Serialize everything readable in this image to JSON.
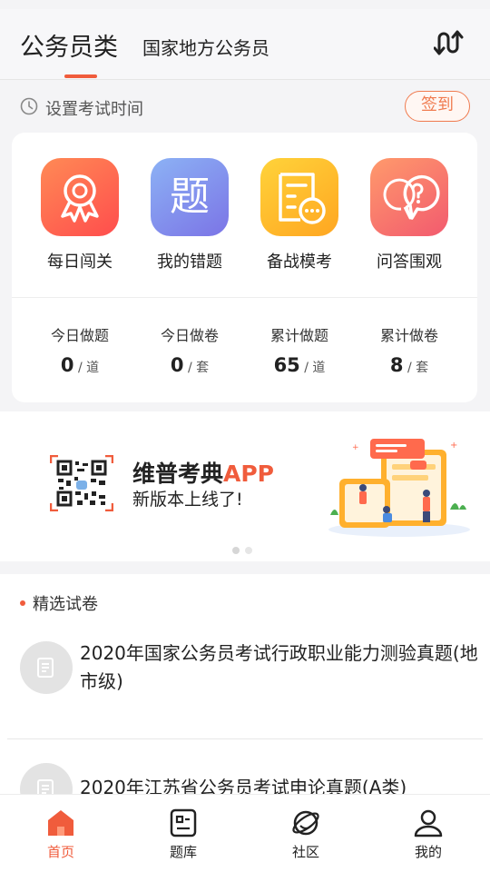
{
  "header": {
    "title": "公务员类",
    "subtitle": "国家地方公务员"
  },
  "exam_time": {
    "label": "设置考试时间",
    "signin_button": "签到"
  },
  "features": [
    {
      "label": "每日闯关",
      "icon": "award-badge-icon"
    },
    {
      "label": "我的错题",
      "icon_text": "题"
    },
    {
      "label": "备战模考",
      "icon": "exam-sheet-icon"
    },
    {
      "label": "问答围观",
      "icon": "question-bubble-icon"
    }
  ],
  "stats": [
    {
      "label": "今日做题",
      "value": "0",
      "unit": "道"
    },
    {
      "label": "今日做卷",
      "value": "0",
      "unit": "套"
    },
    {
      "label": "累计做题",
      "value": "65",
      "unit": "道"
    },
    {
      "label": "累计做卷",
      "value": "8",
      "unit": "套"
    }
  ],
  "banner": {
    "title": "维普考典",
    "title_highlight": "APP",
    "subtitle": "新版本上线了!",
    "page_count": 2,
    "active_page": 1
  },
  "papers": {
    "section_title": "精选试卷",
    "items": [
      {
        "title": "2020年国家公务员考试行政职业能力测验真题(地市级)"
      },
      {
        "title": "2020年江苏省公务员考试申论真题(A类)"
      }
    ]
  },
  "tabbar": {
    "items": [
      {
        "label": "首页",
        "active": true
      },
      {
        "label": "题库",
        "active": false
      },
      {
        "label": "社区",
        "active": false
      },
      {
        "label": "我的",
        "active": false
      }
    ]
  },
  "colors": {
    "accent": "#f05c3c",
    "signin": "#f07b4f",
    "page_bg": "#f4f4f6"
  }
}
